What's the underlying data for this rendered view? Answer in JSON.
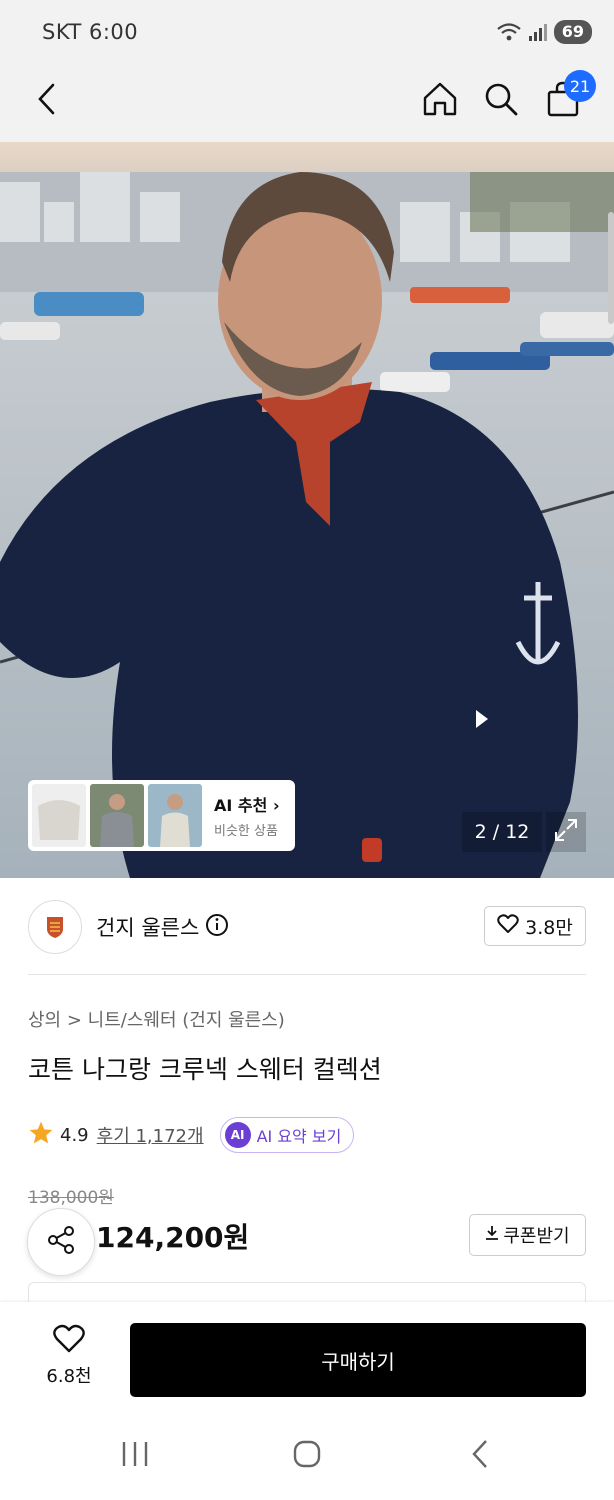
{
  "status": {
    "carrier_time": "SKT 6:00",
    "battery": "69"
  },
  "nav": {
    "back_icon": "chevron-left-icon",
    "home_icon": "home-icon",
    "search_icon": "search-icon",
    "cart_icon": "shopping-bag-icon",
    "cart_count": "21"
  },
  "gallery": {
    "counter": "2 / 12",
    "ai_reco": {
      "title": "AI 추천",
      "subtitle": "비슷한 상품"
    }
  },
  "brand": {
    "name": "건지 울른스",
    "likes": "3.8만"
  },
  "product": {
    "breadcrumb": "상의 > 니트/스웨터 (건지 울른스)",
    "title": "코튼 나그랑 크루넥 스웨터 컬렉션",
    "rating": "4.9",
    "reviews": "후기 1,172개",
    "ai_summary_badge": "AI",
    "ai_summary": "AI 요약 보기",
    "original_price": "138,000원",
    "sale_price": "124,200원",
    "coupon": "쿠폰받기"
  },
  "bottom": {
    "wish_count": "6.8천",
    "buy": "구매하기"
  },
  "colors": {
    "accent_blue": "#1e6bff",
    "ai_purple": "#6b3fd4",
    "star": "#f5a623",
    "discount": "#e43a2f"
  }
}
